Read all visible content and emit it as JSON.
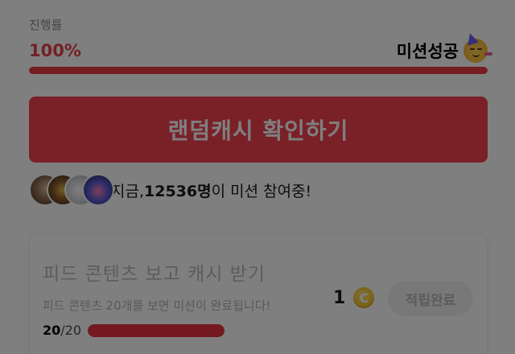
{
  "progress": {
    "label": "진행률",
    "value_text": "100%",
    "percent": 100,
    "status_text": "미션성공",
    "status_icon": "partying-face-icon"
  },
  "cta": {
    "label": "랜덤캐시 확인하기"
  },
  "participants": {
    "prefix": "지금, ",
    "count": "12536명",
    "suffix": "이 미션 참여중!"
  },
  "mission_card": {
    "title": "피드 콘텐츠 보고 캐시 받기",
    "description": "피드 콘텐츠 20개를 보면 미션이 완료됩니다!",
    "progress_current": "20",
    "progress_total": "/20",
    "progress_fraction": 1.0,
    "reward_amount": "1",
    "coin_symbol": "C",
    "claim_label": "적립완료"
  },
  "colors": {
    "accent": "#ec3b47",
    "overlay": "rgba(0,0,0,0.5)"
  }
}
